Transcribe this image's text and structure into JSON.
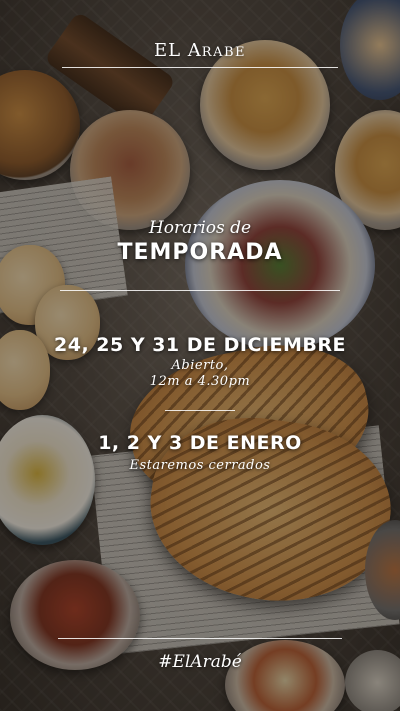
{
  "brand": {
    "name_prefix": "EL ",
    "name_initial": "A",
    "name_rest": "RABE"
  },
  "header": {
    "subtitle": "Horarios de",
    "title": "TEMPORADA"
  },
  "schedule": [
    {
      "dates": "24, 25 Y 31 DE DICIEMBRE",
      "line1": "Abierto,",
      "line2": "12m a 4.30pm"
    },
    {
      "dates": "1, 2 Y 3 DE ENERO",
      "line1": "Estaremos cerrados"
    }
  ],
  "footer": {
    "hashtag": "#ElArabé"
  },
  "colors": {
    "text": "#ffffff",
    "rule": "#ffffff",
    "overlay": "#1c1814"
  }
}
